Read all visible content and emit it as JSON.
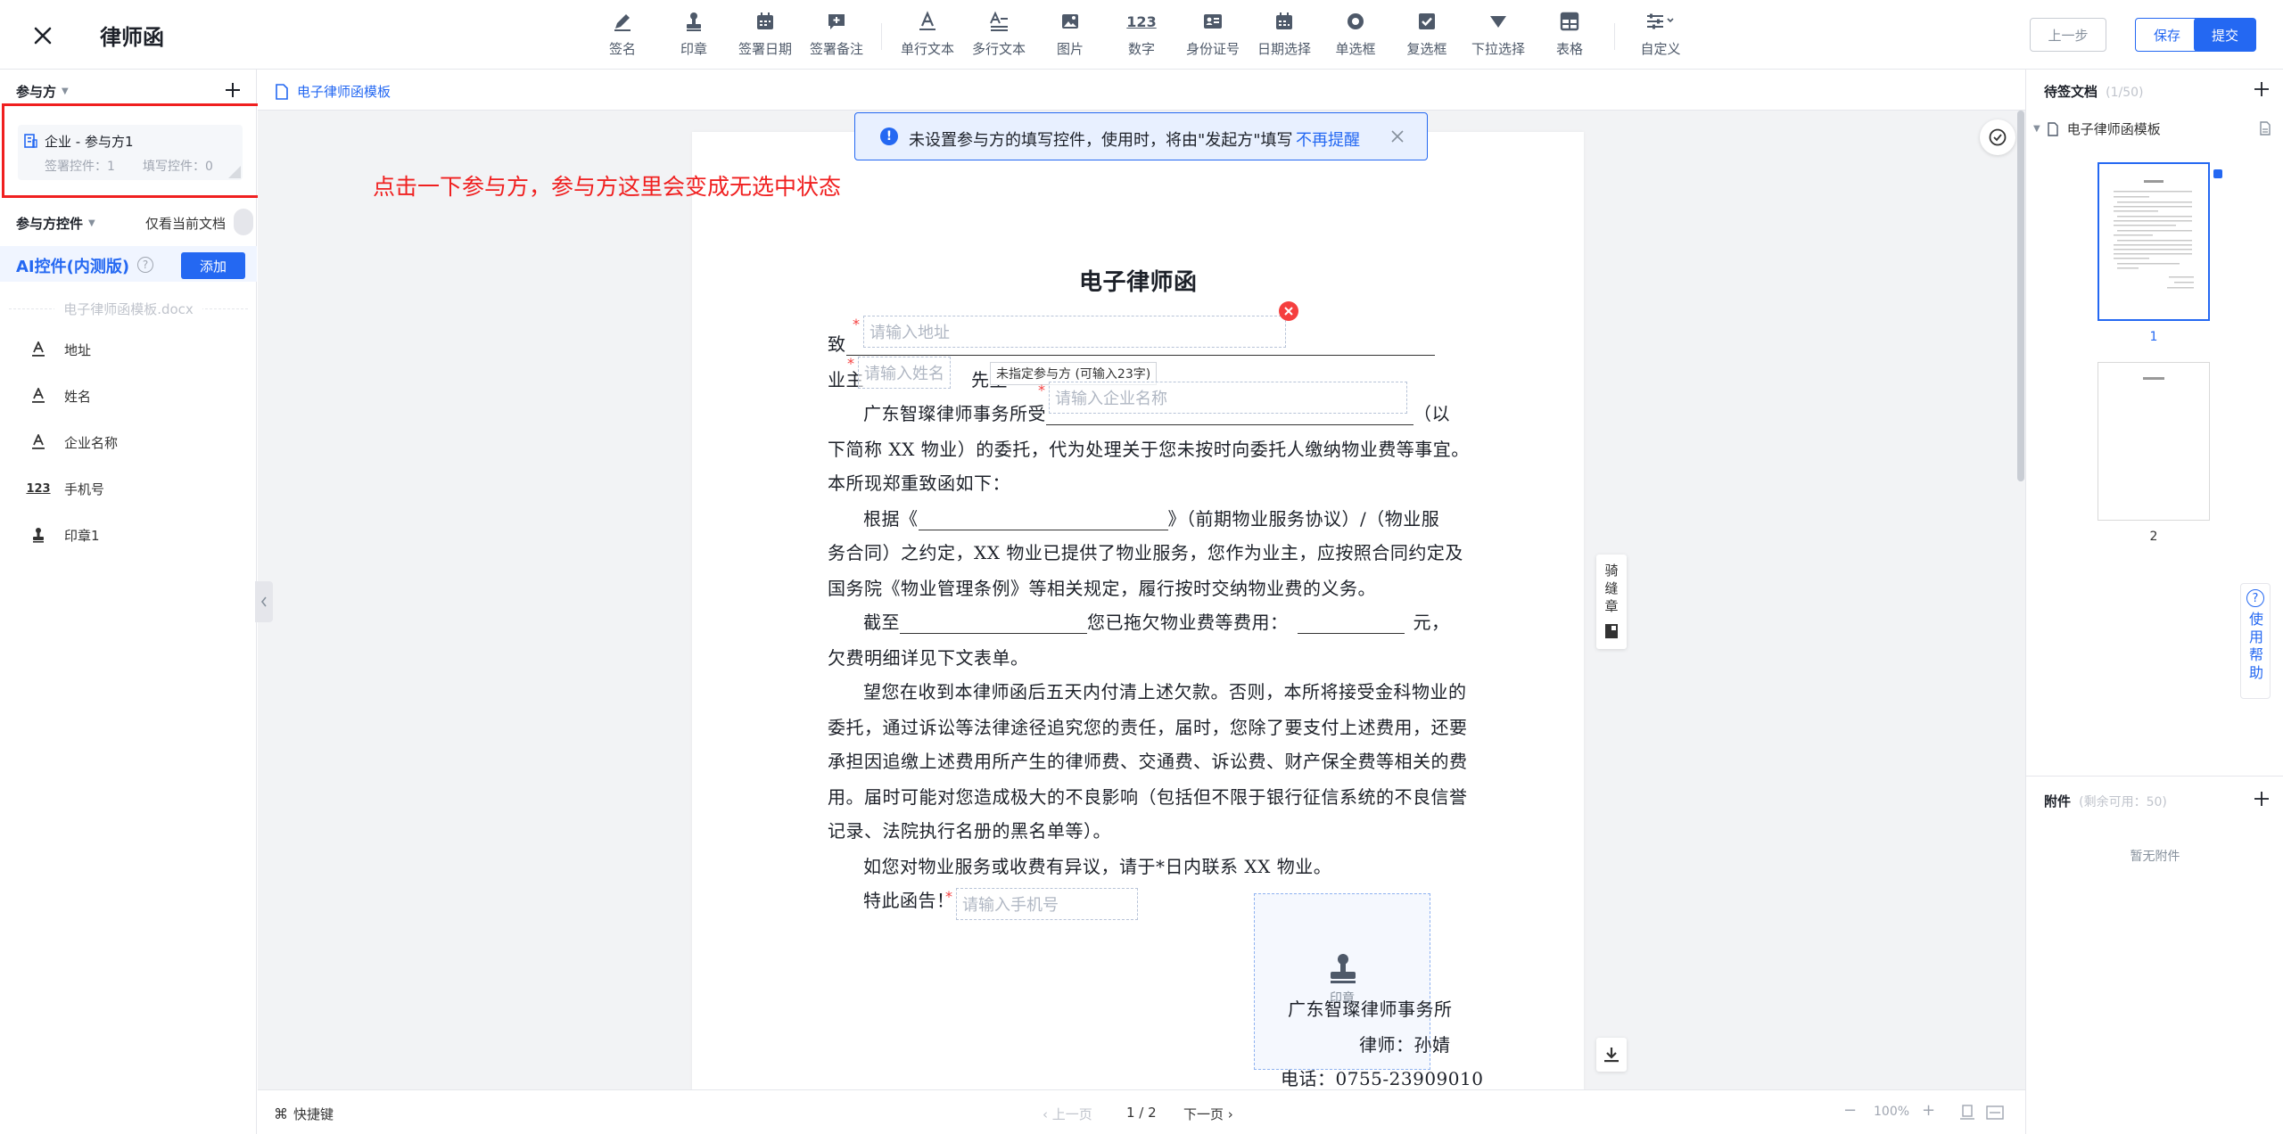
{
  "header": {
    "title": "律师函",
    "tools": [
      {
        "label": "签名",
        "icon": "pen-icon"
      },
      {
        "label": "印章",
        "icon": "stamp-icon"
      },
      {
        "label": "签署日期",
        "icon": "calendar-icon"
      },
      {
        "label": "签署备注",
        "icon": "note-icon"
      },
      {
        "label": "单行文本",
        "icon": "single-text-icon"
      },
      {
        "label": "多行文本",
        "icon": "multi-text-icon"
      },
      {
        "label": "图片",
        "icon": "image-icon"
      },
      {
        "label": "数字",
        "icon": "number-icon"
      },
      {
        "label": "身份证号",
        "icon": "id-card-icon"
      },
      {
        "label": "日期选择",
        "icon": "date-picker-icon"
      },
      {
        "label": "单选框",
        "icon": "radio-icon"
      },
      {
        "label": "复选框",
        "icon": "checkbox-icon"
      },
      {
        "label": "下拉选择",
        "icon": "dropdown-icon"
      },
      {
        "label": "表格",
        "icon": "table-icon"
      },
      {
        "label": "自定义",
        "icon": "custom-icon"
      }
    ],
    "number_glyph": "123",
    "prev_label": "上一步",
    "save_label": "保存",
    "submit_label": "提交"
  },
  "left": {
    "participants_title": "参与方",
    "party_name": "企业 - 参与方1",
    "party_sign_count": "签署控件：1",
    "party_fill_count": "填写控件：0",
    "controls_title": "参与方控件",
    "only_current_doc": "仅看当前文档",
    "ai_title": "AI控件(内测版)",
    "add_label": "添加",
    "doc_name": "电子律师函模板.docx",
    "fields": [
      {
        "label": "地址",
        "icon": "text-field-icon"
      },
      {
        "label": "姓名",
        "icon": "text-field-icon"
      },
      {
        "label": "企业名称",
        "icon": "text-field-icon"
      },
      {
        "label": "手机号",
        "icon": "number-field-icon"
      },
      {
        "label": "印章1",
        "icon": "stamp-icon"
      }
    ]
  },
  "annotation": {
    "text": "点击一下参与方，参与方这里会变成无选中状态"
  },
  "canvas": {
    "tab_title": "电子律师函模板",
    "notice_text": "未设置参与方的填写控件，使用时，将由\"发起方\"填写",
    "notice_link": "不再提醒",
    "seam_label": "骑缝章",
    "doc_title": "电子律师函",
    "to_label": "致",
    "owner_label": "业主",
    "mister": "先生",
    "ph_address": "请输入地址",
    "ph_name": "请输入姓名",
    "ph_company": "请输入企业名称",
    "ph_phone": "请输入手机号",
    "tooltip_unassigned": "未指定参与方 (可输入23字)",
    "stamp_label": "印章",
    "para1_a": "广东智璨律师事务所受",
    "para1_b": "（以",
    "para1_c": "下简称 XX 物业）的委托，代为处理关于您未按时向委托人缴纳物业费等事宜。",
    "para1_d": "本所现郑重致函如下：",
    "para2_a": "根据《",
    "para2_b": "》（前期物业服务协议）/（物业服",
    "para2_c": "务合同）之约定，XX 物业已提供了物业服务，您作为业主，应按照合同约定及",
    "para2_d": "国务院《物业管理条例》等相关规定，履行按时交纳物业费的义务。",
    "para3_a": "截至",
    "para3_b": "您已拖欠物业费等费用：",
    "para3_c": "元，",
    "para3_d": "欠费明细详见下文表单。",
    "para4_a": "望您在收到本律师函后五天内付清上述欠款。否则，本所将接受金科物业的",
    "para4_b": "委托，通过诉讼等法律途径追究您的责任，届时，您除了要支付上述费用，还要",
    "para4_c": "承担因追缴上述费用所产生的律师费、交通费、诉讼费、财产保全费等相关的费",
    "para4_d": "用。届时可能对您造成极大的不良影响（包括但不限于银行征信系统的不良信誉",
    "para4_e": "记录、法院执行名册的黑名单等）。",
    "para5": "如您对物业服务或收费有异议，请于*日内联系 XX 物业。",
    "para6": "特此函告！",
    "sign_firm": "广东智璨律师事务所",
    "sign_lawyer": "律师：孙婧",
    "sign_phone": "电话：0755-23909010"
  },
  "statusbar": {
    "shortcut": "快捷键",
    "prev_page": "上一页",
    "page_indicator": "1 / 2",
    "next_page": "下一页",
    "zoom": "100%"
  },
  "right": {
    "pending_title": "待签文档",
    "pending_count": "(1/50)",
    "doc_name": "电子律师函模板",
    "page1": "1",
    "page2": "2",
    "attach_title": "附件",
    "attach_remaining": "(剩余可用：50)",
    "no_attach": "暂无附件",
    "help": "使用帮助"
  }
}
